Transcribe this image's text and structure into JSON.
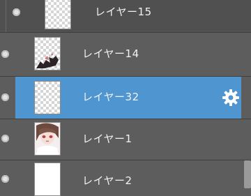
{
  "layers": [
    {
      "label": "レイヤー15"
    },
    {
      "label": "レイヤー14"
    },
    {
      "label": "レイヤー32"
    },
    {
      "label": "レイヤー1"
    },
    {
      "label": "レイヤー2"
    }
  ],
  "selected_layer": "レイヤー32",
  "icons": {
    "selected_settings": "gear-icon",
    "visibility": "eye-toggle-icon"
  },
  "colors": {
    "panel_bg": "#5d5d5d",
    "selected_bg": "#4f96d0",
    "text": "#f2f2f2"
  }
}
